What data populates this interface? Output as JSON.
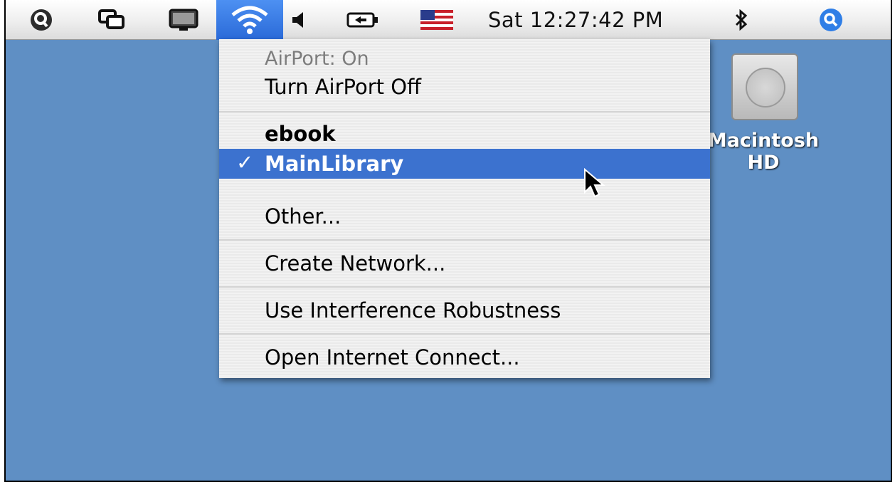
{
  "menubar": {
    "icons": [
      "spotlight-q-icon",
      "display-mirroring-icon",
      "display-icon",
      "wifi-icon",
      "volume-icon",
      "battery-icon",
      "us-flag-icon",
      "bluetooth-icon",
      "spotlight-search-icon"
    ],
    "clock": "Sat 12:27:42 PM"
  },
  "airport_menu": {
    "status": "AirPort: On",
    "toggle": "Turn AirPort Off",
    "networks": [
      {
        "name": "ebook",
        "checked": false
      },
      {
        "name": "MainLibrary",
        "checked": true
      }
    ],
    "check_mark": "✓",
    "other": "Other...",
    "create": "Create Network...",
    "interference": "Use Interference Robustness",
    "internet_connect": "Open Internet Connect..."
  },
  "desktop": {
    "drive_label": "Macintosh HD"
  },
  "colors": {
    "desktop": "#5f8fc4",
    "selection": "#3c72cf",
    "menubar_highlight": "#3a7be0"
  }
}
